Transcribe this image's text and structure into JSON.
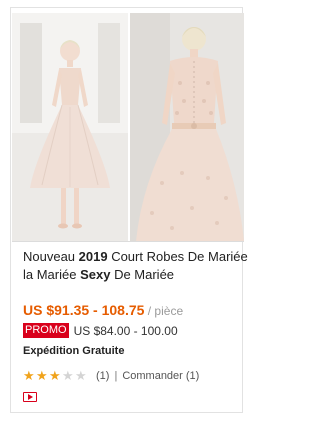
{
  "product": {
    "title_parts": {
      "p1": "Nouveau ",
      "year": "2019",
      "p2": " Court Robes De Mariée la Mariée ",
      "bold_word": "Sexy",
      "p3": " De Mariée"
    },
    "price_range": "US $91.35 - 108.75",
    "unit": " / pièce",
    "promo_label": "PROMO",
    "promo_price": "US $84.00 - 100.00",
    "shipping": "Expédition Gratuite",
    "rating": 3,
    "rating_max": 5,
    "rating_count": "(1)",
    "separator": "|",
    "orders": "Commander (1)",
    "video_icon": "video-icon"
  },
  "colors": {
    "price": "#e65c00",
    "promo_badge": "#d9001b",
    "star_on": "#f0a31c",
    "star_off": "#d4d4d4"
  }
}
